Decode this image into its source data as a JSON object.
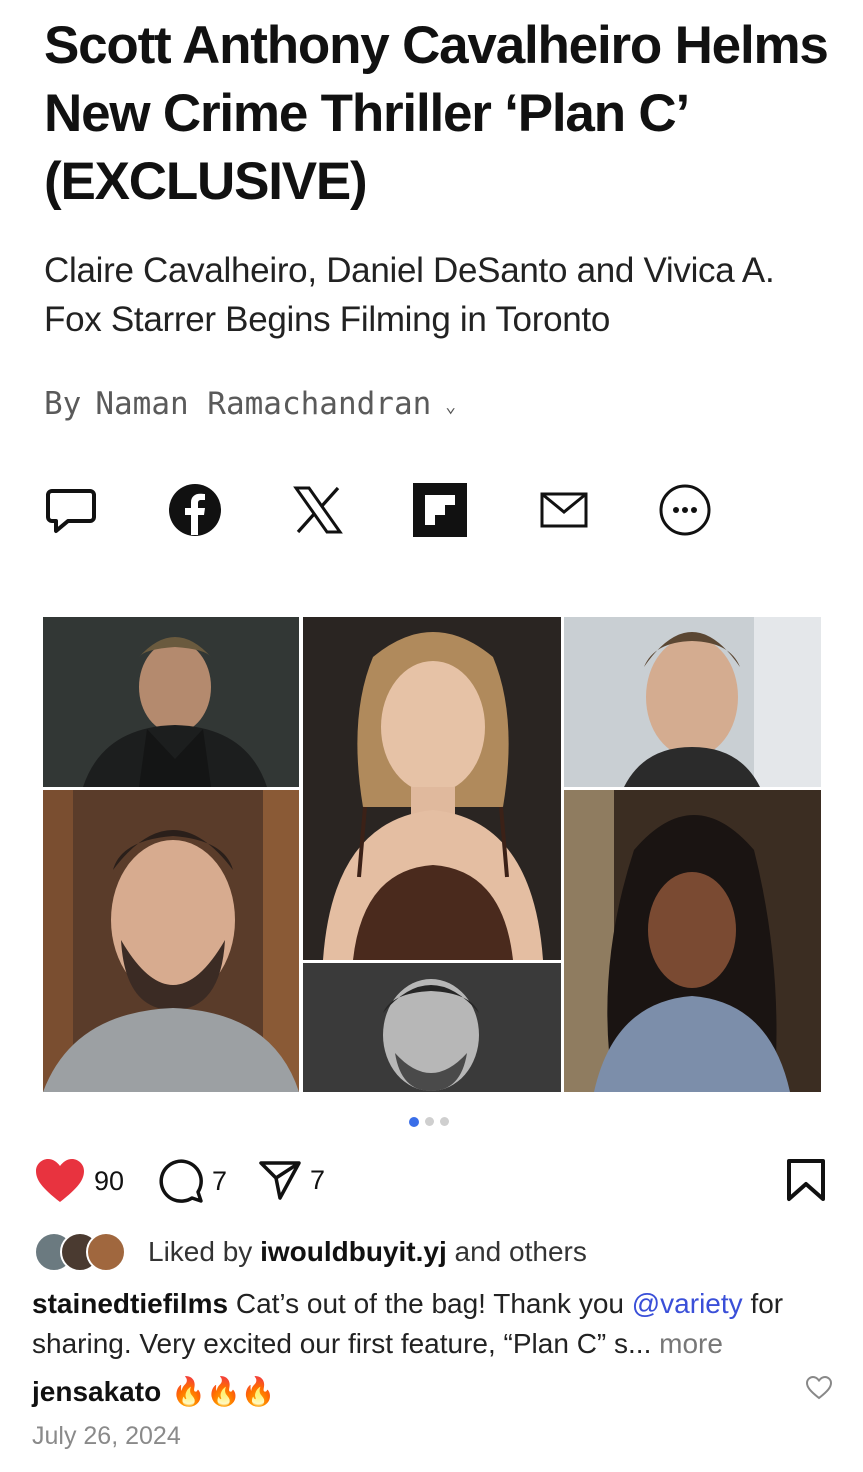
{
  "article": {
    "headline": "Scott Anthony Cavalheiro Helms New Crime Thriller ‘Plan C’ (EXCLUSIVE)",
    "subheadline": "Claire Cavalheiro, Daniel DeSanto and Vivica A. Fox Starrer Begins Filming in Toronto",
    "byline_prefix": "By",
    "author": "Naman Ramachandran"
  },
  "share_icons": [
    "comment-icon",
    "facebook-icon",
    "x-icon",
    "flipboard-icon",
    "email-icon",
    "more-icon"
  ],
  "carousel": {
    "total": 3,
    "active_index": 0
  },
  "post": {
    "likes": "90",
    "comments": "7",
    "shares": "7",
    "liked_by_prefix": "Liked by",
    "liked_by_user": "iwouldbuyit.yj",
    "liked_by_suffix": "and others",
    "author": "stainedtiefilms",
    "caption_text_1": "Cat’s out of the bag! Thank you",
    "caption_mention": "@variety",
    "caption_text_2": "for sharing. Very excited our first feature, “Plan C” s...",
    "caption_more": "more",
    "comment_user": "jensakato",
    "comment_text": "🔥🔥🔥",
    "date": "July 26, 2024"
  },
  "colors": {
    "like": "#e8333f",
    "mention": "#3a4fd8",
    "dot_active": "#3a6ee8"
  }
}
